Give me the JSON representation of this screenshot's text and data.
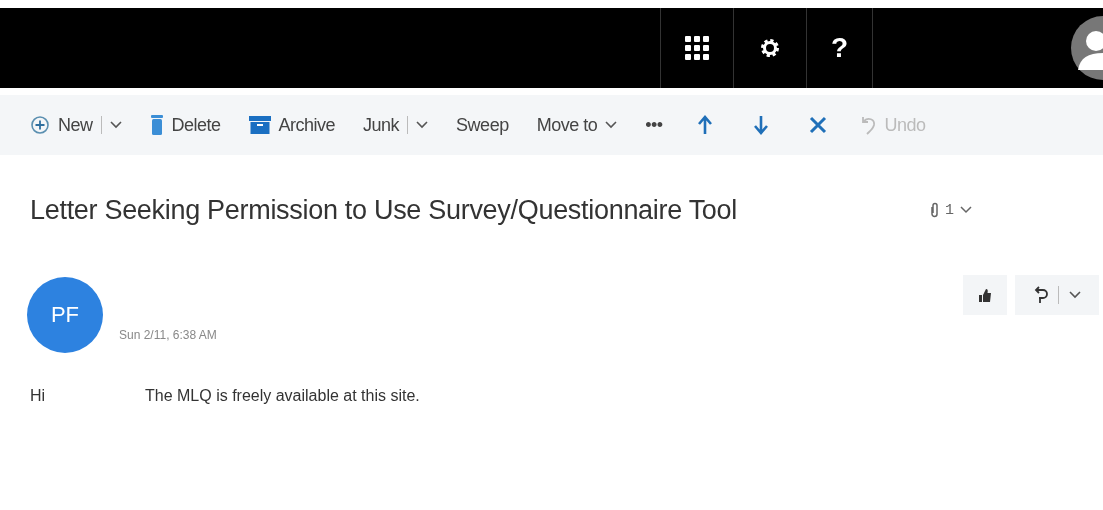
{
  "top_bar": {
    "help": "?"
  },
  "toolbar": [
    {
      "kind": "split",
      "label": "New",
      "disabled": false
    },
    {
      "kind": "plain",
      "label": "Delete",
      "disabled": false
    },
    {
      "kind": "plain",
      "label": "Archive",
      "disabled": false
    },
    {
      "kind": "split",
      "label": "Junk",
      "disabled": false
    },
    {
      "kind": "plain",
      "label": "Sweep",
      "disabled": false
    },
    {
      "kind": "menu",
      "label": "Move to",
      "disabled": false
    },
    {
      "kind": "more",
      "label": "•••",
      "disabled": false
    },
    {
      "kind": "icon",
      "disabled": false
    },
    {
      "kind": "icon",
      "disabled": false
    },
    {
      "kind": "icon",
      "disabled": false
    },
    {
      "kind": "plain",
      "label": "Undo",
      "disabled": true
    }
  ],
  "message": {
    "subject": "Letter Seeking Permission to Use Survey/Questionnaire Tool",
    "attachment_count": "1",
    "sender_initials": "PF",
    "date": "Sun 2/11, 6:38 AM",
    "greeting": "Hi",
    "body": "The MLQ is freely available at this site."
  }
}
